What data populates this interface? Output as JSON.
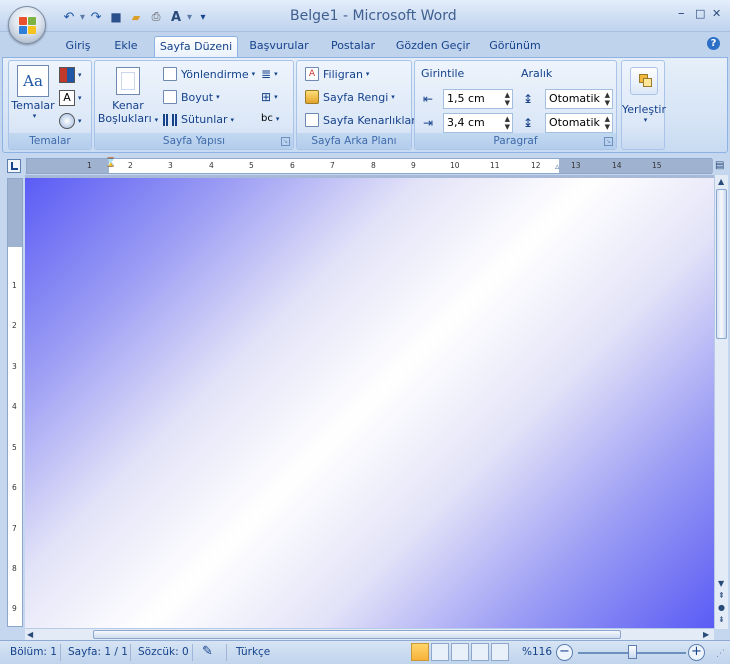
{
  "window": {
    "title": "Belge1 - Microsoft Word",
    "minimize": "–",
    "maximize": "□",
    "close": "✕"
  },
  "qat": {
    "undo": "↶",
    "redo": "↷",
    "save": "■",
    "open": "📂",
    "preview": "🔍",
    "spell": "A",
    "customize": "▾"
  },
  "tabs": [
    "Giriş",
    "Ekle",
    "Sayfa Düzeni",
    "Başvurular",
    "Postalar",
    "Gözden Geçir",
    "Görünüm"
  ],
  "active_tab": "Sayfa Düzeni",
  "ribbon": {
    "temalar": {
      "button": "Temalar",
      "label": "Temalar"
    },
    "sayfa_yapisi": {
      "kenar": "Kenar",
      "bosluklari": "Boşlukları",
      "yonlendirme": "Yönlendirme",
      "boyut": "Boyut",
      "sutunlar": "Sütunlar",
      "label": "Sayfa Yapısı"
    },
    "sayfa_arka_plani": {
      "filigran": "Filigran",
      "sayfa_rengi": "Sayfa Rengi",
      "kenarliklar": "Sayfa Kenarlıkları",
      "label": "Sayfa Arka Planı"
    },
    "paragraf": {
      "girintile": "Girintile",
      "aralik": "Aralık",
      "left_indent": "1,5 cm",
      "right_indent": "3,4 cm",
      "space_before": "Otomatik",
      "space_after": "Otomatik",
      "label": "Paragraf"
    },
    "yerlestir": {
      "button": "Yerleştir"
    }
  },
  "ruler_numbers": [
    "1",
    "2",
    "3",
    "4",
    "5",
    "6",
    "7",
    "8",
    "9",
    "10",
    "11",
    "12",
    "13",
    "14",
    "15"
  ],
  "ruler_v_numbers": [
    "1",
    "2",
    "3",
    "4",
    "5",
    "6",
    "7",
    "8",
    "9"
  ],
  "statusbar": {
    "bolum": "Bölüm: 1",
    "sayfa": "Sayfa: 1 / 1",
    "sozcuk": "Sözcük: 0",
    "dil": "Türkçe",
    "zoom": "%116"
  },
  "colors": {
    "page_gradient_edge": "#5a5cf5",
    "page_gradient_center": "#ffffff",
    "accent": "#15428b"
  }
}
